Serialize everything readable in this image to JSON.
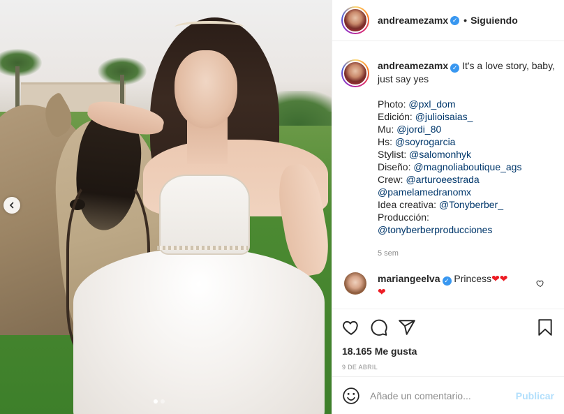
{
  "post": {
    "image_alt": "",
    "carousel": {
      "dots": 2,
      "active_index": 0
    }
  },
  "header": {
    "username": "andreamezamx",
    "separator": "•",
    "follow_status": "Siguiendo"
  },
  "caption": {
    "username": "andreamezamx",
    "text": "It's a love story, baby, just say yes",
    "lines": [
      {
        "label": "Photo: ",
        "mention": "@pxl_dom"
      },
      {
        "label": "Edición: ",
        "mention": "@julioisaias_"
      },
      {
        "label": "Mu: ",
        "mention": "@jordi_80"
      },
      {
        "label": "Hs: ",
        "mention": "@soyrogarcia"
      },
      {
        "label": "Stylist: ",
        "mention": "@salomonhyk"
      },
      {
        "label": "Diseño: ",
        "mention": "@magnoliaboutique_ags"
      },
      {
        "label": "Crew: ",
        "mention": "@arturoeestrada"
      },
      {
        "label": "",
        "mention": "@pamelamedranomx"
      },
      {
        "label": "Idea creativa: ",
        "mention": "@Tonyberber_"
      },
      {
        "label": "Producción: ",
        "mention": ""
      },
      {
        "label": "",
        "mention": "@tonyberberproducciones"
      }
    ],
    "time_ago": "5 sem"
  },
  "reply": {
    "username": "mariangeelva",
    "text": "Princess",
    "hearts_inline": "❤❤",
    "hearts_next_line": "❤"
  },
  "actions": {
    "likes": "18.165 Me gusta",
    "date": "9 DE ABRIL"
  },
  "add_comment": {
    "placeholder": "Añade un comentario...",
    "publish_label": "Publicar"
  },
  "colors": {
    "link": "#00376b",
    "verified": "#3897f0",
    "publish_disabled": "#b2dffc",
    "meta_gray": "#8e8e8e"
  }
}
